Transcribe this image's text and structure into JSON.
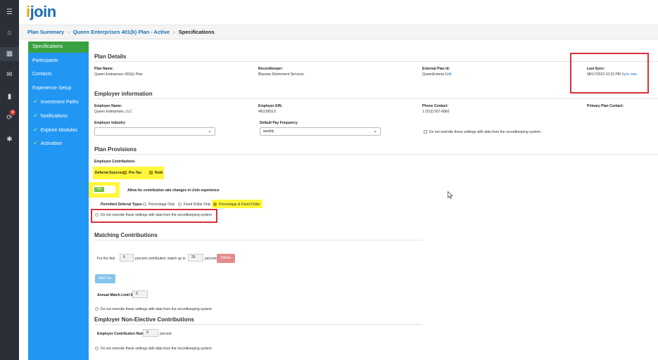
{
  "rail": {
    "icons": [
      "menu-icon",
      "home-icon",
      "grid-icon",
      "mail-icon",
      "chart-icon",
      "notification-icon",
      "gear-icon"
    ],
    "glyphs": [
      "☰",
      "⌂",
      "▦",
      "✉",
      "▮",
      "⟳",
      "✱"
    ],
    "badge": "8"
  },
  "header": {
    "logo_i": "i",
    "logo_rest": "join"
  },
  "breadcrumb": {
    "items": [
      "Plan Summary",
      "Queen Enterprises 401(k) Plan - Active"
    ],
    "current": "Specifications",
    "separator": "›"
  },
  "subnav": {
    "items": [
      {
        "label": "Specifications",
        "active": true,
        "checked": false
      },
      {
        "label": "Participants",
        "active": false,
        "checked": false
      },
      {
        "label": "Contacts",
        "active": false,
        "checked": false
      },
      {
        "label": "Experience Setup",
        "active": false,
        "checked": false
      },
      {
        "label": "Investment Paths",
        "active": false,
        "checked": true
      },
      {
        "label": "Notifications",
        "active": false,
        "checked": true
      },
      {
        "label": "Explore Modules",
        "active": false,
        "checked": true
      },
      {
        "label": "Activation",
        "active": false,
        "checked": true
      }
    ],
    "check_glyph": "✔"
  },
  "plan_details": {
    "title": "Plan Details",
    "plan_name_label": "Plan Name:",
    "plan_name": "Queen Enterprises 401(k) Plan",
    "recordkeeper_label": "Recordkeeper:",
    "recordkeeper": "Bluestar Retirement Services",
    "external_id_label": "External Plan Id:",
    "external_id": "QueenEnterpr",
    "external_edit": "Edit",
    "last_sync_label": "Last Sync:",
    "last_sync": "08/17/2023 10:21 PM",
    "sync_now": "Sync now"
  },
  "employer": {
    "title": "Employer information",
    "name_label": "Employer Name:",
    "name": "Queen Enterprises, LLC",
    "ein_label": "Employer EIN:",
    "ein": "481158313",
    "phone_label": "Phone Contact:",
    "phone": "1 (913) 557-6860",
    "primary_label": "Primary Plan Contact:",
    "industry_label": "Employer Industry",
    "industry_value": "",
    "pay_freq_label": "Default Pay Frequency",
    "pay_freq_value": "weekly",
    "override": "Do not override these settings with data from the recordkeeping system."
  },
  "provisions": {
    "title": "Plan Provisions",
    "employee_title": "Employee Contributions",
    "deferral_label": "Deferral Sources",
    "pretax": "Pre-Tax",
    "roth": "Roth",
    "toggle_on": "On",
    "allow_label": "Allow for contribution rate changes in iJoin experience",
    "permitted_label": "Permitted Deferral Types",
    "opt_percentage": "Percentage Only",
    "opt_fixed": "Fixed Dollar Only",
    "opt_both": "Percentage & Fixed Dollar",
    "override": "Do not override these settings with data from the recordkeeping system"
  },
  "matching": {
    "title": "Matching Contributions",
    "for_first": "For the first",
    "first_value": "5",
    "percent_contributed": "percent contributed, match up to",
    "match_value": "25",
    "percent": "percent",
    "delete": "Delete",
    "add_tier": "Add Tier",
    "annual_limit_label": "Annual Match Limit $",
    "annual_limit_value": "0",
    "override": "Do not override these settings with data from the recordkeeping system"
  },
  "non_elective": {
    "title": "Employer Non-Elective Contributions",
    "rate_label": "Employer Contribution Rate",
    "rate_value": "0",
    "percent": "percent",
    "override": "Do not override these settings with data from the recordkeeping system"
  },
  "colors": {
    "rail": "#2b3038",
    "subnav": "#2196f3",
    "active": "#3aa142",
    "highlight": "#fff73b",
    "annotation": "#d9303a",
    "link": "#1a6fb0"
  }
}
